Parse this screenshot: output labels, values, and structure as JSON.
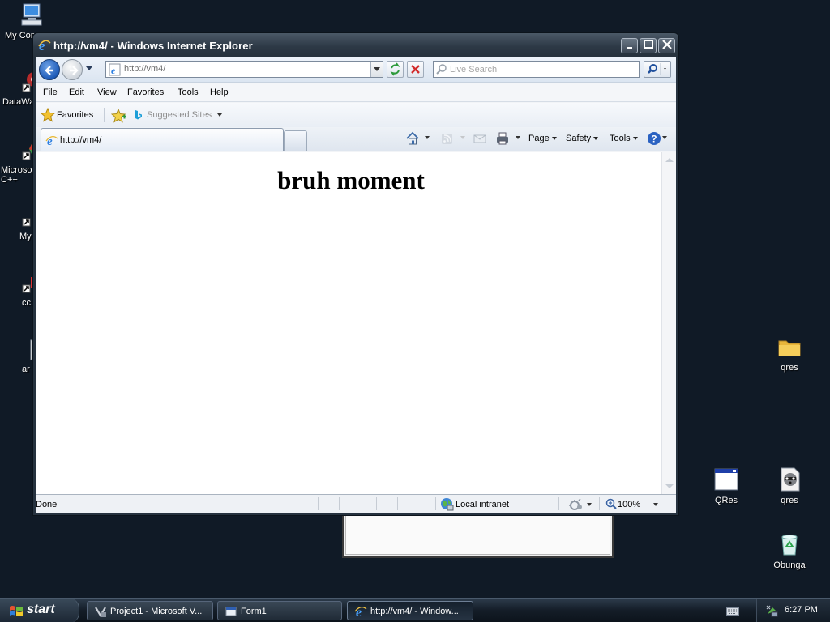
{
  "desktop": {
    "left_icons": [
      {
        "label": "My Com"
      },
      {
        "label": "DataWa"
      },
      {
        "label": "Microsol\nC++"
      },
      {
        "label": "My"
      },
      {
        "label": "cc"
      },
      {
        "label": "ar"
      }
    ],
    "right_icons": [
      {
        "label": "qres"
      },
      {
        "label": "QRes"
      },
      {
        "label": "qres"
      },
      {
        "label": "Obunga"
      }
    ]
  },
  "browser": {
    "title": "http://vm4/ - Windows Internet Explorer",
    "address": "http://vm4/",
    "search_placeholder": "Live Search",
    "menu": [
      "File",
      "Edit",
      "View",
      "Favorites",
      "Tools",
      "Help"
    ],
    "favorites_label": "Favorites",
    "suggested_sites_label": "Suggested Sites",
    "tab_label": "http://vm4/",
    "commands": {
      "page": "Page",
      "safety": "Safety",
      "tools": "Tools"
    },
    "page_heading": "bruh moment",
    "status": {
      "text": "Done",
      "zone": "Local intranet",
      "zoom": "100%"
    }
  },
  "taskbar": {
    "start_label": "start",
    "buttons": [
      {
        "label": "Project1 - Microsoft V...",
        "active": false
      },
      {
        "label": "Form1",
        "active": false
      },
      {
        "label": "http://vm4/ - Window...",
        "active": true
      }
    ],
    "clock": "6:27 PM"
  }
}
